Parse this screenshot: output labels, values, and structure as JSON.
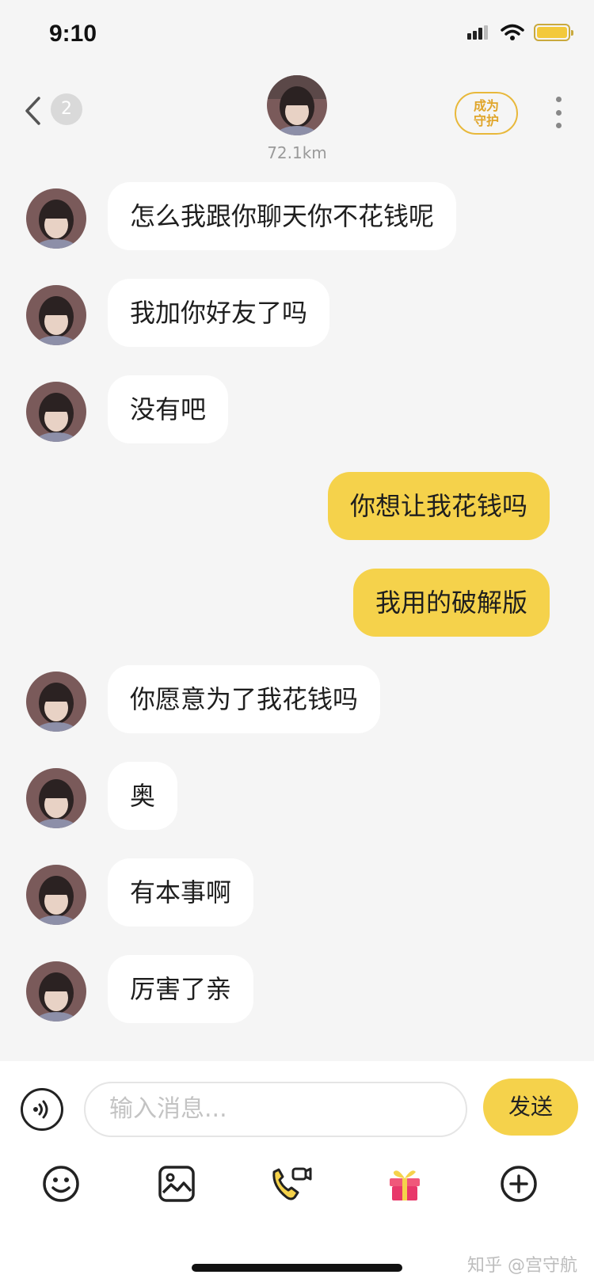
{
  "status_bar": {
    "time": "9:10"
  },
  "header": {
    "unread_count": "2",
    "distance": "72.1km",
    "guard_button": "成为\n守护"
  },
  "messages": [
    {
      "side": "in",
      "text": "怎么我跟你聊天你不花钱呢"
    },
    {
      "side": "in",
      "text": "我加你好友了吗"
    },
    {
      "side": "in",
      "text": "没有吧"
    },
    {
      "side": "out",
      "text": "你想让我花钱吗"
    },
    {
      "side": "out",
      "text": "我用的破解版"
    },
    {
      "side": "in",
      "text": "你愿意为了我花钱吗"
    },
    {
      "side": "in",
      "text": "奥"
    },
    {
      "side": "in",
      "text": "有本事啊"
    },
    {
      "side": "in",
      "text": "厉害了亲"
    }
  ],
  "input": {
    "placeholder": "输入消息...",
    "send_label": "发送"
  },
  "toolbar": {
    "icons": [
      "emoji-icon",
      "image-icon",
      "call-icon",
      "gift-icon",
      "plus-icon"
    ]
  },
  "watermark": "知乎 @宫守航",
  "colors": {
    "accent": "#f5d24b",
    "guard": "#e8b83a",
    "background": "#f5f5f5"
  }
}
